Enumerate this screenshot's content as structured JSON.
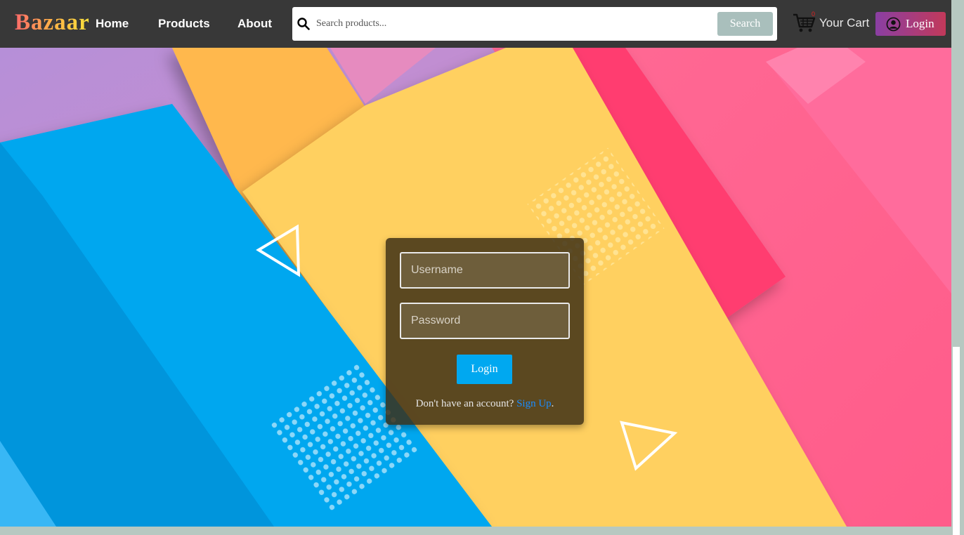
{
  "navbar": {
    "brand": "Bazaar",
    "links": [
      "Home",
      "Products",
      "About"
    ],
    "search": {
      "placeholder": "Search products...",
      "button_label": "Search"
    },
    "cart": {
      "count": "0",
      "label": "Your Cart"
    },
    "login_label": "Login"
  },
  "login_form": {
    "username_placeholder": "Username",
    "password_placeholder": "Password",
    "submit_label": "Login",
    "signup_prompt": "Don't have an account?",
    "signup_link": "Sign Up",
    "signup_suffix": "."
  },
  "colors": {
    "navbar_bg": "#383838",
    "search_button": "#a9bfbc",
    "login_button": "#00a8f0",
    "signup_link": "#1a8cff"
  },
  "icons": {
    "search": "search-icon",
    "cart": "cart-icon",
    "user": "user-circle-icon"
  }
}
